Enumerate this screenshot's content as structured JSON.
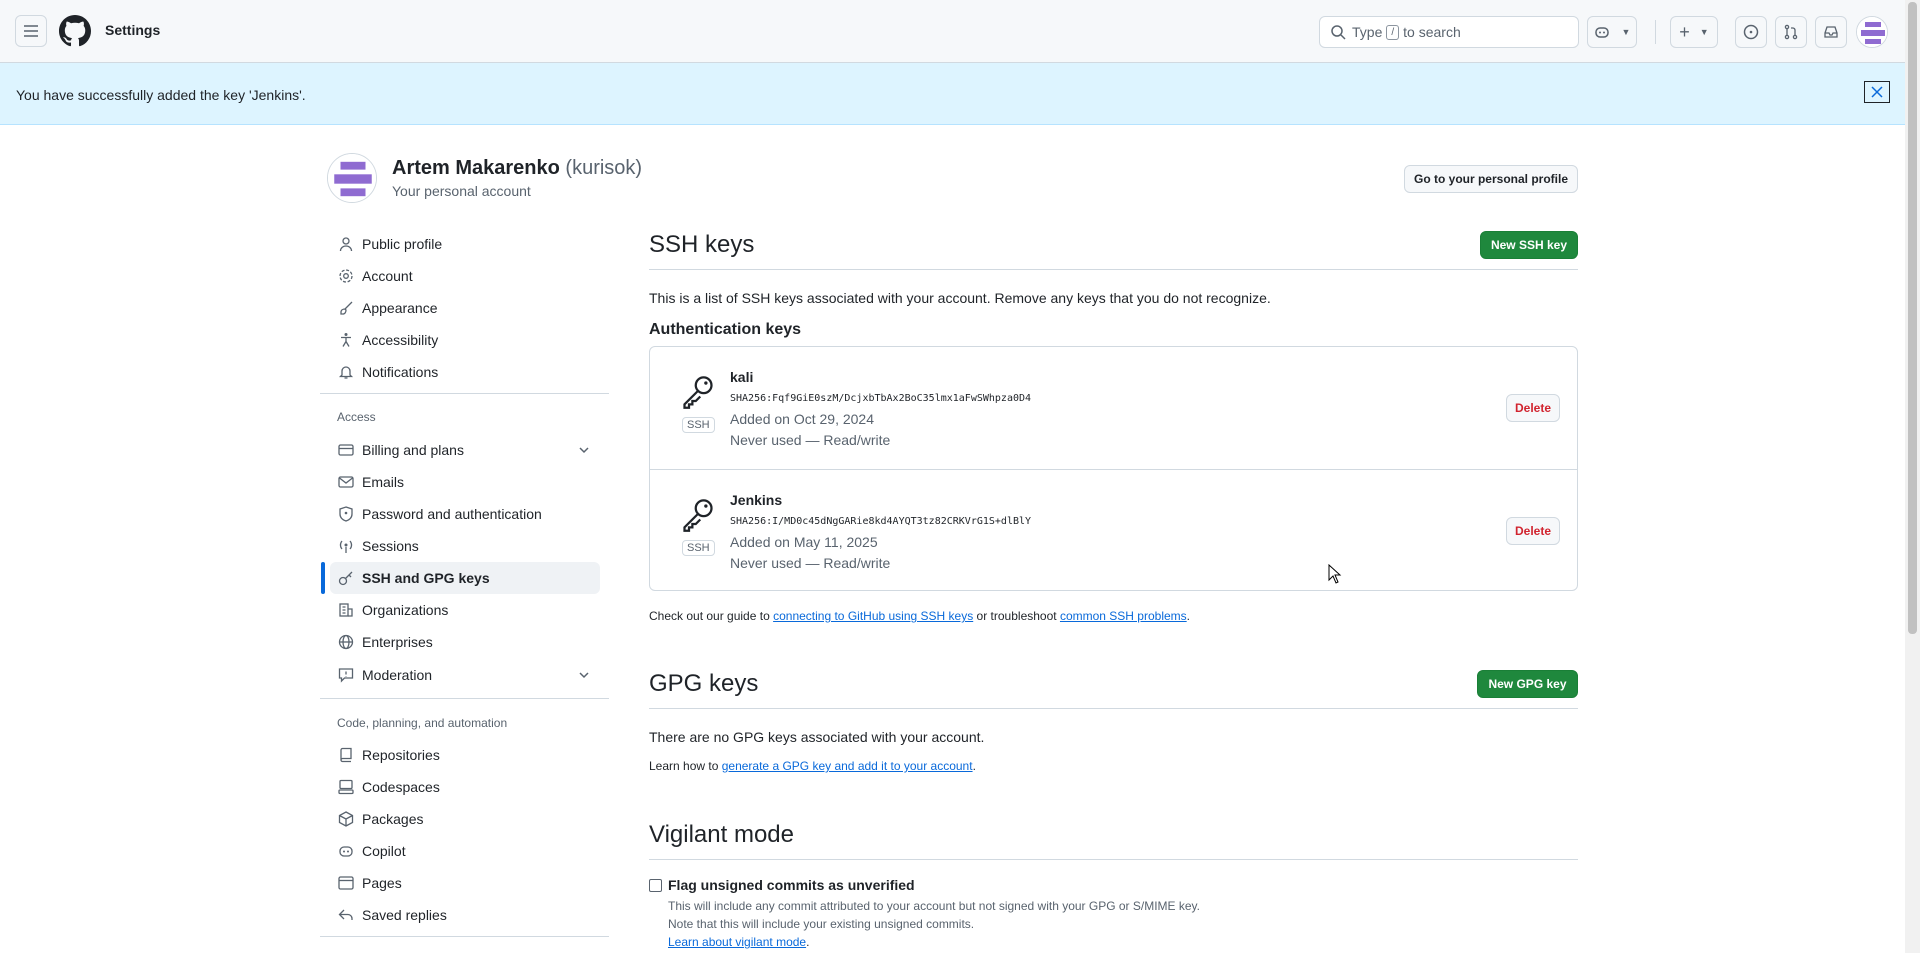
{
  "header": {
    "context_title": "Settings",
    "search_prefix": "Type",
    "search_key": "/",
    "search_suffix": "to search"
  },
  "flash": {
    "message": "You have successfully added the key 'Jenkins'."
  },
  "profile": {
    "name": "Artem Makarenko",
    "login": "(kurisok)",
    "subtitle": "Your personal account",
    "go_profile_button": "Go to your personal profile"
  },
  "sidebar": {
    "items": [
      {
        "label": "Public profile",
        "icon": "person-icon"
      },
      {
        "label": "Account",
        "icon": "gear-icon"
      },
      {
        "label": "Appearance",
        "icon": "paintbrush-icon"
      },
      {
        "label": "Accessibility",
        "icon": "accessibility-icon"
      },
      {
        "label": "Notifications",
        "icon": "bell-icon"
      }
    ],
    "access_heading": "Access",
    "access_items": [
      {
        "label": "Billing and plans",
        "icon": "credit-card-icon"
      },
      {
        "label": "Emails",
        "icon": "mail-icon"
      },
      {
        "label": "Password and authentication",
        "icon": "shield-lock-icon"
      },
      {
        "label": "Sessions",
        "icon": "broadcast-icon"
      },
      {
        "label": "SSH and GPG keys",
        "icon": "key-icon"
      },
      {
        "label": "Organizations",
        "icon": "organization-icon"
      },
      {
        "label": "Enterprises",
        "icon": "globe-icon"
      },
      {
        "label": "Moderation",
        "icon": "report-icon"
      }
    ],
    "code_heading": "Code, planning, and automation",
    "code_items": [
      {
        "label": "Repositories",
        "icon": "repo-icon"
      },
      {
        "label": "Codespaces",
        "icon": "codespaces-icon"
      },
      {
        "label": "Packages",
        "icon": "package-icon"
      },
      {
        "label": "Copilot",
        "icon": "copilot-icon"
      },
      {
        "label": "Pages",
        "icon": "browser-icon"
      },
      {
        "label": "Saved replies",
        "icon": "reply-icon"
      }
    ]
  },
  "ssh": {
    "title": "SSH keys",
    "new_button": "New SSH key",
    "description": "This is a list of SSH keys associated with your account. Remove any keys that you do not recognize.",
    "auth_heading": "Authentication keys",
    "keys": [
      {
        "title": "kali",
        "fingerprint": "SHA256:Fqf9GiE0szM/DcjxbTbAx2BoC35lmx1aFwSWhpza0D4",
        "added": "Added on Oct 29, 2024",
        "usage": "Never used — Read/write",
        "badge": "SSH",
        "delete_label": "Delete"
      },
      {
        "title": "Jenkins",
        "fingerprint": "SHA256:I/MD0c45dNgGARie8kd4AYQT3tz82CRKVrG1S+dlBlY",
        "added": "Added on May 11, 2025",
        "usage": "Never used — Read/write",
        "badge": "SSH",
        "delete_label": "Delete"
      }
    ],
    "guide_prefix": "Check out our guide to",
    "guide_link": "connecting to GitHub using SSH keys",
    "guide_middle": "or troubleshoot",
    "guide_link2": "common SSH problems",
    "guide_suffix": "."
  },
  "gpg": {
    "title": "GPG keys",
    "new_button": "New GPG key",
    "empty": "There are no GPG keys associated with your account.",
    "learn_prefix": "Learn how to",
    "learn_link": "generate a GPG key and add it to your account",
    "learn_suffix": "."
  },
  "vigilant": {
    "title": "Vigilant mode",
    "checkbox_label": "Flag unsigned commits as unverified",
    "line1": "This will include any commit attributed to your account but not signed with your GPG or S/MIME key.",
    "line2": "Note that this will include your existing unsigned commits.",
    "link": "Learn about vigilant mode",
    "link_suffix": "."
  },
  "colors": {
    "accent": "#0969da",
    "primary_button": "#1f883d",
    "danger": "#d1242f",
    "flash_bg": "#ddf4ff"
  }
}
